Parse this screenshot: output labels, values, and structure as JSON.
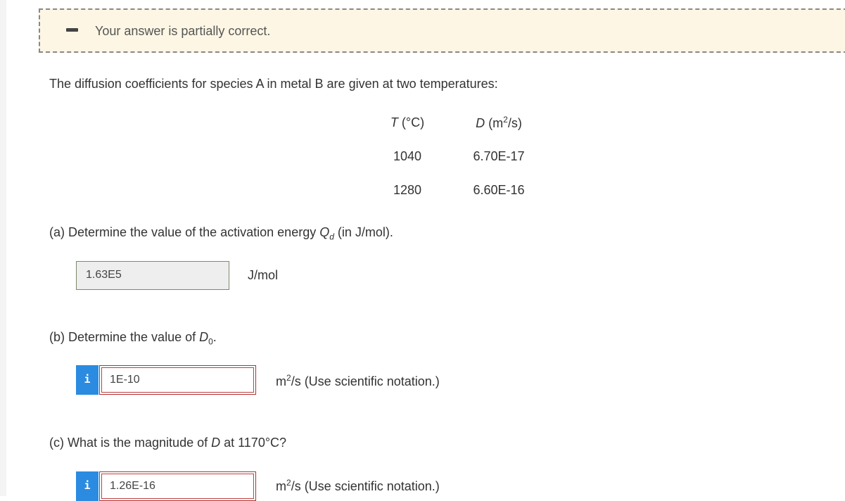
{
  "banner": {
    "message": "Your answer is partially correct."
  },
  "intro": "The diffusion coefficients for species A in metal B are given at two temperatures:",
  "table": {
    "header_t_sym": "T",
    "header_t_unit": "(°C)",
    "header_d_sym": "D",
    "header_d_unit_pre": "(m",
    "header_d_unit_sup": "2",
    "header_d_unit_post": "/s)",
    "rows": [
      {
        "t": "1040",
        "d": "6.70E-17"
      },
      {
        "t": "1280",
        "d": "6.60E-16"
      }
    ]
  },
  "part_a": {
    "question_pre": "(a) Determine the value of the activation energy ",
    "q_sym": "Q",
    "q_sub": "d",
    "question_post": " (in J/mol).",
    "answer": "1.63E5",
    "unit": "J/mol"
  },
  "part_b": {
    "question_pre": "(b) Determine the value of ",
    "d_sym": "D",
    "d_sub": "0",
    "question_post": ".",
    "info_icon": "i",
    "answer": "1E-10",
    "unit_pre": "m",
    "unit_sup": "2",
    "unit_post": "/s (Use scientific notation.)"
  },
  "part_c": {
    "question_pre": "(c) What is the magnitude of ",
    "d_sym": "D",
    "question_post": " at 1170°C?",
    "info_icon": "i",
    "answer": "1.26E-16",
    "unit_pre": "m",
    "unit_sup": "2",
    "unit_post": "/s (Use scientific notation.)"
  },
  "colors": {
    "banner_bg": "#fdf6e4",
    "info_button": "#2b8be0",
    "incorrect_border": "#b03030"
  }
}
